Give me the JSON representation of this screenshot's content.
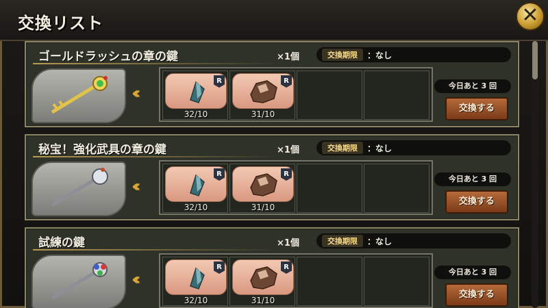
{
  "title": "交換リスト",
  "close_label": "✕",
  "rows": [
    {
      "name": "ゴールドラッシュの章の鍵",
      "quantity": "×1個",
      "period_label": "交換期限",
      "period_sep": "：",
      "period_value": "なし",
      "key_icon": "gold-key-icon",
      "arrows": "‹‹‹",
      "materials": [
        {
          "icon": "blue-crystal-icon",
          "rarity": "R",
          "count": "32/10"
        },
        {
          "icon": "ore-chunk-icon",
          "rarity": "R",
          "count": "31/10"
        }
      ],
      "remaining": "今日あと 3 回",
      "button": "交換する"
    },
    {
      "name": "秘宝！強化武具の章の鍵",
      "quantity": "×1個",
      "period_label": "交換期限",
      "period_sep": "：",
      "period_value": "なし",
      "key_icon": "silver-key-icon",
      "arrows": "‹‹‹",
      "materials": [
        {
          "icon": "blue-crystal-icon",
          "rarity": "R",
          "count": "32/10"
        },
        {
          "icon": "ore-chunk-icon",
          "rarity": "R",
          "count": "31/10"
        }
      ],
      "remaining": "今日あと 3 回",
      "button": "交換する"
    },
    {
      "name": "試練の鍵",
      "quantity": "×1個",
      "period_label": "交換期限",
      "period_sep": "：",
      "period_value": "なし",
      "key_icon": "jeweled-key-icon",
      "arrows": "‹‹‹",
      "materials": [
        {
          "icon": "blue-crystal-icon",
          "rarity": "R",
          "count": "32/10"
        },
        {
          "icon": "ore-chunk-icon",
          "rarity": "R",
          "count": "31/10"
        }
      ],
      "remaining": "今日あと 3 回",
      "button": "交換する"
    }
  ]
}
